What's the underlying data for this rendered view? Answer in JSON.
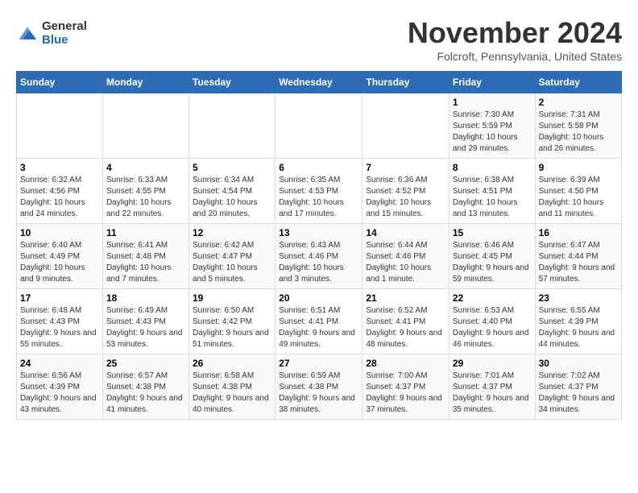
{
  "logo": {
    "general": "General",
    "blue": "Blue"
  },
  "title": "November 2024",
  "location": "Folcroft, Pennsylvania, United States",
  "days_of_week": [
    "Sunday",
    "Monday",
    "Tuesday",
    "Wednesday",
    "Thursday",
    "Friday",
    "Saturday"
  ],
  "weeks": [
    [
      {
        "day": "",
        "info": ""
      },
      {
        "day": "",
        "info": ""
      },
      {
        "day": "",
        "info": ""
      },
      {
        "day": "",
        "info": ""
      },
      {
        "day": "",
        "info": ""
      },
      {
        "day": "1",
        "info": "Sunrise: 7:30 AM\nSunset: 5:59 PM\nDaylight: 10 hours and 29 minutes."
      },
      {
        "day": "2",
        "info": "Sunrise: 7:31 AM\nSunset: 5:58 PM\nDaylight: 10 hours and 26 minutes."
      }
    ],
    [
      {
        "day": "3",
        "info": "Sunrise: 6:32 AM\nSunset: 4:56 PM\nDaylight: 10 hours and 24 minutes."
      },
      {
        "day": "4",
        "info": "Sunrise: 6:33 AM\nSunset: 4:55 PM\nDaylight: 10 hours and 22 minutes."
      },
      {
        "day": "5",
        "info": "Sunrise: 6:34 AM\nSunset: 4:54 PM\nDaylight: 10 hours and 20 minutes."
      },
      {
        "day": "6",
        "info": "Sunrise: 6:35 AM\nSunset: 4:53 PM\nDaylight: 10 hours and 17 minutes."
      },
      {
        "day": "7",
        "info": "Sunrise: 6:36 AM\nSunset: 4:52 PM\nDaylight: 10 hours and 15 minutes."
      },
      {
        "day": "8",
        "info": "Sunrise: 6:38 AM\nSunset: 4:51 PM\nDaylight: 10 hours and 13 minutes."
      },
      {
        "day": "9",
        "info": "Sunrise: 6:39 AM\nSunset: 4:50 PM\nDaylight: 10 hours and 11 minutes."
      }
    ],
    [
      {
        "day": "10",
        "info": "Sunrise: 6:40 AM\nSunset: 4:49 PM\nDaylight: 10 hours and 9 minutes."
      },
      {
        "day": "11",
        "info": "Sunrise: 6:41 AM\nSunset: 4:48 PM\nDaylight: 10 hours and 7 minutes."
      },
      {
        "day": "12",
        "info": "Sunrise: 6:42 AM\nSunset: 4:47 PM\nDaylight: 10 hours and 5 minutes."
      },
      {
        "day": "13",
        "info": "Sunrise: 6:43 AM\nSunset: 4:46 PM\nDaylight: 10 hours and 3 minutes."
      },
      {
        "day": "14",
        "info": "Sunrise: 6:44 AM\nSunset: 4:46 PM\nDaylight: 10 hours and 1 minute."
      },
      {
        "day": "15",
        "info": "Sunrise: 6:46 AM\nSunset: 4:45 PM\nDaylight: 9 hours and 59 minutes."
      },
      {
        "day": "16",
        "info": "Sunrise: 6:47 AM\nSunset: 4:44 PM\nDaylight: 9 hours and 57 minutes."
      }
    ],
    [
      {
        "day": "17",
        "info": "Sunrise: 6:48 AM\nSunset: 4:43 PM\nDaylight: 9 hours and 55 minutes."
      },
      {
        "day": "18",
        "info": "Sunrise: 6:49 AM\nSunset: 4:43 PM\nDaylight: 9 hours and 53 minutes."
      },
      {
        "day": "19",
        "info": "Sunrise: 6:50 AM\nSunset: 4:42 PM\nDaylight: 9 hours and 51 minutes."
      },
      {
        "day": "20",
        "info": "Sunrise: 6:51 AM\nSunset: 4:41 PM\nDaylight: 9 hours and 49 minutes."
      },
      {
        "day": "21",
        "info": "Sunrise: 6:52 AM\nSunset: 4:41 PM\nDaylight: 9 hours and 48 minutes."
      },
      {
        "day": "22",
        "info": "Sunrise: 6:53 AM\nSunset: 4:40 PM\nDaylight: 9 hours and 46 minutes."
      },
      {
        "day": "23",
        "info": "Sunrise: 6:55 AM\nSunset: 4:39 PM\nDaylight: 9 hours and 44 minutes."
      }
    ],
    [
      {
        "day": "24",
        "info": "Sunrise: 6:56 AM\nSunset: 4:39 PM\nDaylight: 9 hours and 43 minutes."
      },
      {
        "day": "25",
        "info": "Sunrise: 6:57 AM\nSunset: 4:38 PM\nDaylight: 9 hours and 41 minutes."
      },
      {
        "day": "26",
        "info": "Sunrise: 6:58 AM\nSunset: 4:38 PM\nDaylight: 9 hours and 40 minutes."
      },
      {
        "day": "27",
        "info": "Sunrise: 6:59 AM\nSunset: 4:38 PM\nDaylight: 9 hours and 38 minutes."
      },
      {
        "day": "28",
        "info": "Sunrise: 7:00 AM\nSunset: 4:37 PM\nDaylight: 9 hours and 37 minutes."
      },
      {
        "day": "29",
        "info": "Sunrise: 7:01 AM\nSunset: 4:37 PM\nDaylight: 9 hours and 35 minutes."
      },
      {
        "day": "30",
        "info": "Sunrise: 7:02 AM\nSunset: 4:37 PM\nDaylight: 9 hours and 34 minutes."
      }
    ]
  ]
}
